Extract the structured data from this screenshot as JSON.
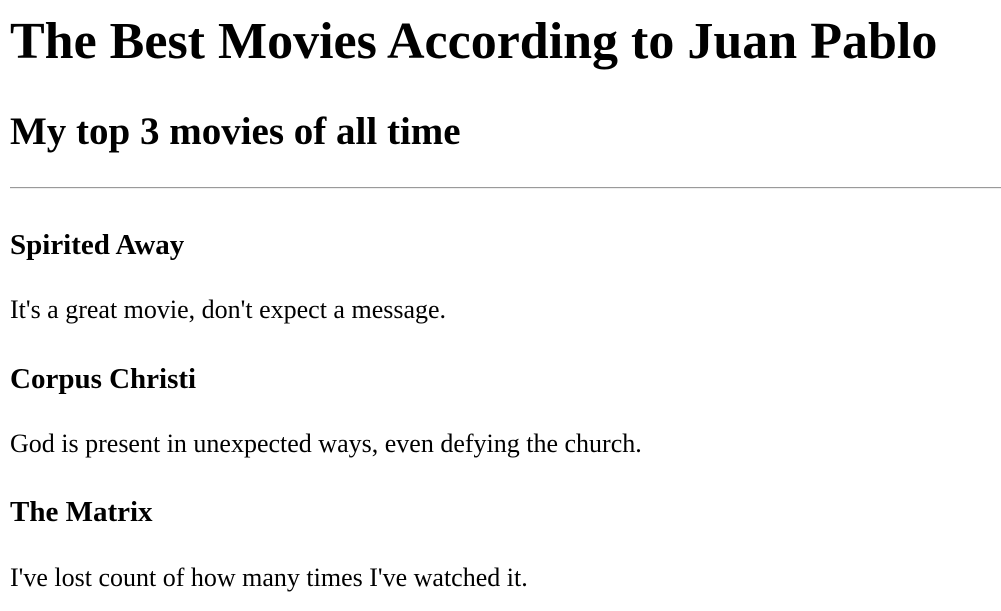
{
  "header": {
    "title": "The Best Movies According to Juan Pablo",
    "subtitle": "My top 3 movies of all time"
  },
  "movies": [
    {
      "title": "Spirited Away",
      "description": "It's a great movie, don't expect a message."
    },
    {
      "title": "Corpus Christi",
      "description": "God is present in unexpected ways, even defying the church."
    },
    {
      "title": "The Matrix",
      "description": "I've lost count of how many times I've watched it."
    }
  ]
}
